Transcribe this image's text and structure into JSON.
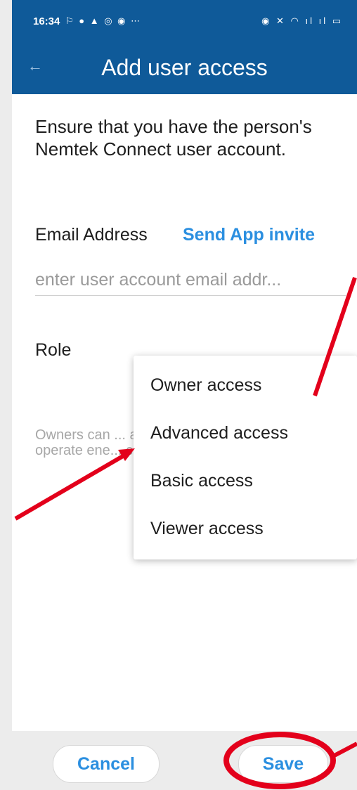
{
  "status_bar": {
    "time": "16:34",
    "left_icons": "⚐ ● ▲ ◎ ◉ ⋯",
    "right_icons": "◉ ✕ ◠ ıl ıl ▭"
  },
  "app_bar": {
    "title": "Add user access",
    "back_icon": "arrow-left-icon"
  },
  "form": {
    "intro": "Ensure that you have the person's Nemtek Connect user account.",
    "email_label": "Email Address",
    "invite_link": "Send App invite",
    "email_placeholder": "enter user account email addr...",
    "role_label": "Role",
    "role_description": "Owners can ... access. Adv... configuratio... operate ene... configuratio... only view si..."
  },
  "role_dropdown": {
    "options": [
      "Owner access",
      "Advanced access",
      "Basic access",
      "Viewer access"
    ]
  },
  "buttons": {
    "cancel": "Cancel",
    "save": "Save"
  },
  "colors": {
    "header": "#0f5a99",
    "accent": "#2b8fe0",
    "annotation": "#e3001b"
  }
}
